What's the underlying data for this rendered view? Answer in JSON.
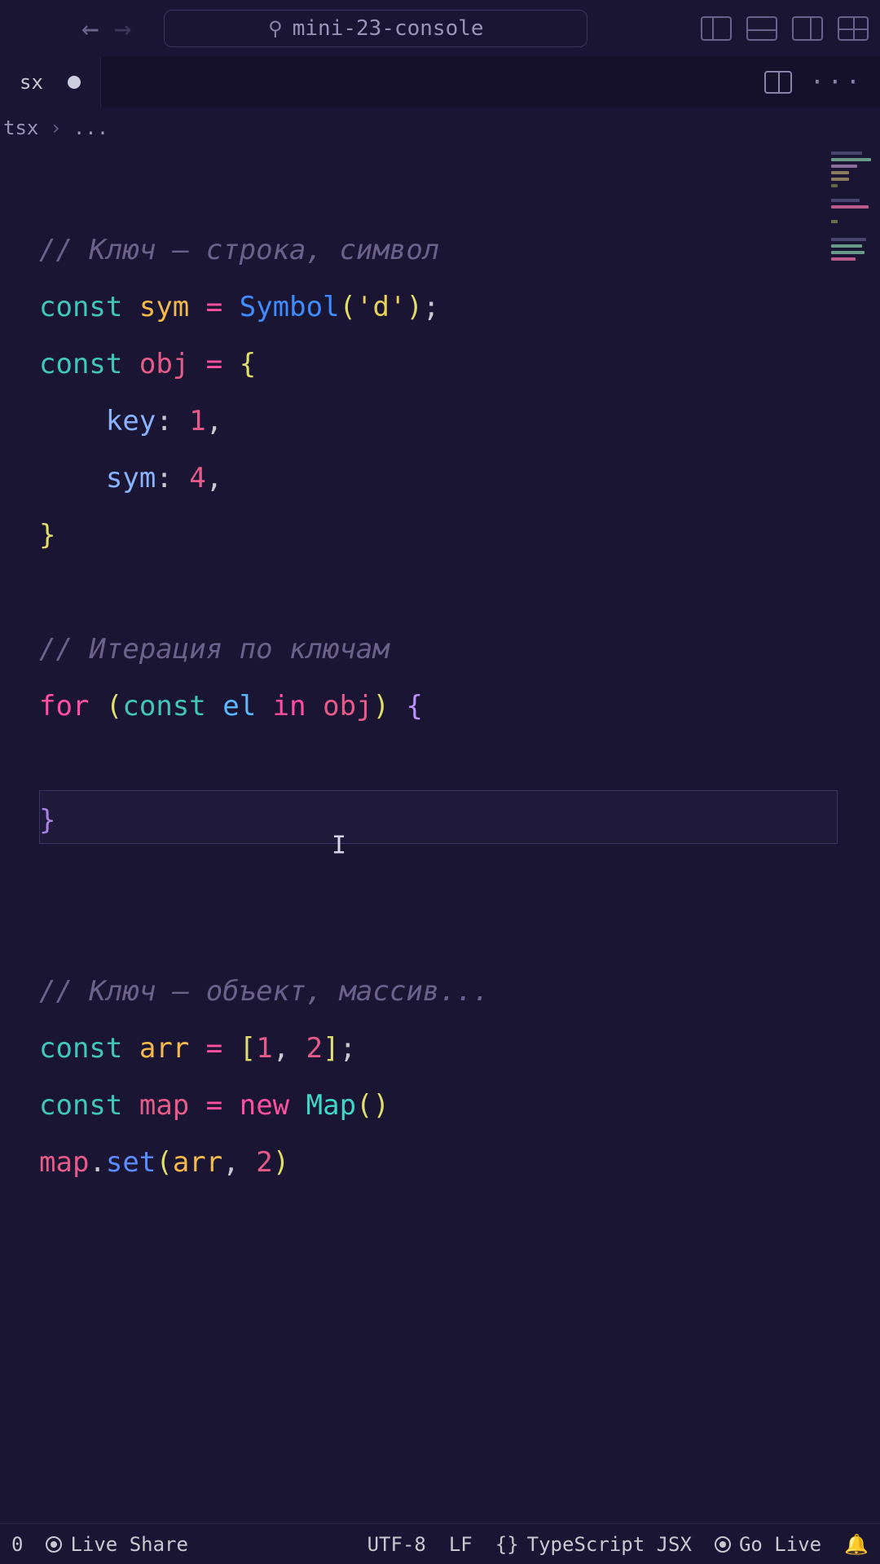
{
  "title_bar": {
    "search_text": "mini-23-console"
  },
  "tab": {
    "filename": "sx"
  },
  "breadcrumb": {
    "file": "tsx",
    "rest": "..."
  },
  "code": {
    "l1_comment": "// Ключ — строка, символ",
    "l2_const": "const",
    "l2_sym": "sym",
    "l2_eq": "=",
    "l2_symbol": "Symbol",
    "l2_open": "(",
    "l2_str": "'d'",
    "l2_close": ")",
    "l2_semi": ";",
    "l3_const": "const",
    "l3_obj": "obj",
    "l3_eq": "=",
    "l3_brace": "{",
    "l4_key": "key",
    "l4_colon": ":",
    "l4_val": "1",
    "l4_comma": ",",
    "l5_key": "sym",
    "l5_colon": ":",
    "l5_val": "4",
    "l5_comma": ",",
    "l6_brace": "}",
    "l8_comment": "// Итерация по ключам",
    "l9_for": "for",
    "l9_open": "(",
    "l9_const": "const",
    "l9_el": "el",
    "l9_in": "in",
    "l9_obj": "obj",
    "l9_close": ")",
    "l9_brace": "{",
    "l11_brace": "}",
    "l14_comment": "// Ключ — объект, массив...",
    "l15_const": "const",
    "l15_arr": "arr",
    "l15_eq": "=",
    "l15_open": "[",
    "l15_v1": "1",
    "l15_comma": ",",
    "l15_v2": "2",
    "l15_close": "]",
    "l15_semi": ";",
    "l16_const": "const",
    "l16_map": "map",
    "l16_eq": "=",
    "l16_new": "new",
    "l16_Map": "Map",
    "l16_open": "(",
    "l16_close": ")",
    "l17_map": "map",
    "l17_dot": ".",
    "l17_set": "set",
    "l17_open": "(",
    "l17_arr": "arr",
    "l17_comma": ",",
    "l17_v": "2",
    "l17_close": ")"
  },
  "status": {
    "col": "0",
    "live_share": "Live Share",
    "encoding": "UTF-8",
    "eol": "LF",
    "lang": "TypeScript JSX",
    "go_live": "Go Live"
  }
}
